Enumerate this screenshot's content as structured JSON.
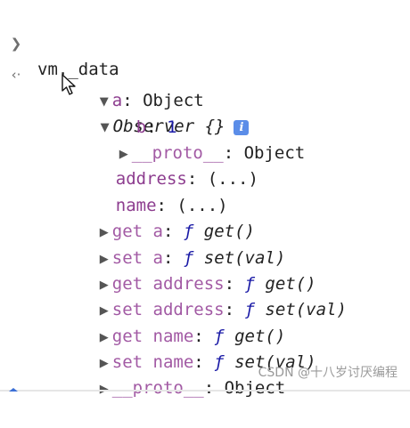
{
  "console": {
    "input_prompt_icon": "chevron-right-icon",
    "input_text": "vm._data",
    "output_prompt_icon": "return-arrow-icon",
    "result_label": "Observer {}",
    "info_icon_glyph": "i",
    "tree": {
      "a_key": "a",
      "a_value": "Object",
      "b_key": "b",
      "b_value": "1",
      "inner_proto_key": "__proto__",
      "inner_proto_value": "Object",
      "address_key": "address",
      "address_value": "(...)",
      "name_key": "name",
      "name_value": "(...)",
      "getters": [
        {
          "key": "get a",
          "f": "ƒ",
          "fn": "get()"
        },
        {
          "key": "set a",
          "f": "ƒ",
          "fn": "set(val)"
        },
        {
          "key": "get address",
          "f": "ƒ",
          "fn": "get()"
        },
        {
          "key": "set address",
          "f": "ƒ",
          "fn": "set(val)"
        },
        {
          "key": "get name",
          "f": "ƒ",
          "fn": "get()"
        },
        {
          "key": "set name",
          "f": "ƒ",
          "fn": "set(val)"
        }
      ],
      "outer_proto_key": "__proto__",
      "outer_proto_value": "Object"
    }
  },
  "watermark": "CSDN @十八岁讨厌编程",
  "colors": {
    "property_key": "#8d3d8f",
    "accessor_key": "#a25aa4",
    "number": "#1a1aa6",
    "info_icon_bg": "#5b8de8"
  }
}
